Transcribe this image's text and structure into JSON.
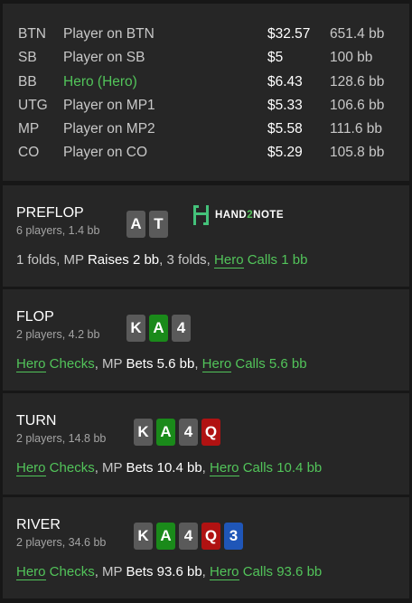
{
  "players": [
    {
      "pos": "BTN",
      "name": "Player on BTN",
      "stack": "$32.57",
      "bb": "651.4 bb",
      "hero": false
    },
    {
      "pos": "SB",
      "name": "Player on SB",
      "stack": "$5",
      "bb": "100 bb",
      "hero": false
    },
    {
      "pos": "BB",
      "name": "Hero (Hero)",
      "stack": "$6.43",
      "bb": "128.6 bb",
      "hero": true
    },
    {
      "pos": "UTG",
      "name": "Player on MP1",
      "stack": "$5.33",
      "bb": "106.6 bb",
      "hero": false
    },
    {
      "pos": "MP",
      "name": "Player on MP2",
      "stack": "$5.58",
      "bb": "111.6 bb",
      "hero": false
    },
    {
      "pos": "CO",
      "name": "Player on CO",
      "stack": "$5.29",
      "bb": "105.8 bb",
      "hero": false
    }
  ],
  "logo": {
    "text_a": "HAND",
    "text_b": "2",
    "text_c": "NOTE"
  },
  "colors": {
    "spade": "#5a5a5a",
    "club": "#1a8a1a",
    "heart": "#b01212",
    "diamond": "#1f56b8",
    "hero_green": "#52c45a"
  },
  "streets": [
    {
      "title": "PREFLOP",
      "sub": "6 players, 1.4 bb",
      "cards": [
        {
          "rank": "A",
          "suit": "spade"
        },
        {
          "rank": "T",
          "suit": "spade"
        }
      ],
      "action": {
        "p1": "1 folds, MP ",
        "w1": "Raises 2 bb",
        "p2": ", 3 folds, ",
        "hero": "Hero",
        "g1": " Calls 1 bb"
      }
    },
    {
      "title": "FLOP",
      "sub": "2 players, 4.2 bb",
      "cards": [
        {
          "rank": "K",
          "suit": "spade"
        },
        {
          "rank": "A",
          "suit": "club"
        },
        {
          "rank": "4",
          "suit": "spade"
        }
      ],
      "action": {
        "hero1": "Hero",
        "g1": " Checks",
        "p1": ", MP ",
        "w1": "Bets 5.6 bb",
        "p2": ", ",
        "hero2": "Hero",
        "g2": " Calls 5.6 bb"
      }
    },
    {
      "title": "TURN",
      "sub": "2 players, 14.8 bb",
      "cards": [
        {
          "rank": "K",
          "suit": "spade"
        },
        {
          "rank": "A",
          "suit": "club"
        },
        {
          "rank": "4",
          "suit": "spade"
        },
        {
          "rank": "Q",
          "suit": "heart"
        }
      ],
      "action": {
        "hero1": "Hero",
        "g1": " Checks",
        "p1": ", MP ",
        "w1": "Bets 10.4 bb",
        "p2": ", ",
        "hero2": "Hero",
        "g2": " Calls 10.4 bb"
      }
    },
    {
      "title": "RIVER",
      "sub": "2 players, 34.6 bb",
      "cards": [
        {
          "rank": "K",
          "suit": "spade"
        },
        {
          "rank": "A",
          "suit": "club"
        },
        {
          "rank": "4",
          "suit": "spade"
        },
        {
          "rank": "Q",
          "suit": "heart"
        },
        {
          "rank": "3",
          "suit": "diamond"
        }
      ],
      "action": {
        "hero1": "Hero",
        "g1": " Checks",
        "p1": ", MP ",
        "w1": "Bets 93.6 bb",
        "p2": ", ",
        "hero2": "Hero",
        "g2": " Calls 93.6 bb"
      }
    }
  ]
}
